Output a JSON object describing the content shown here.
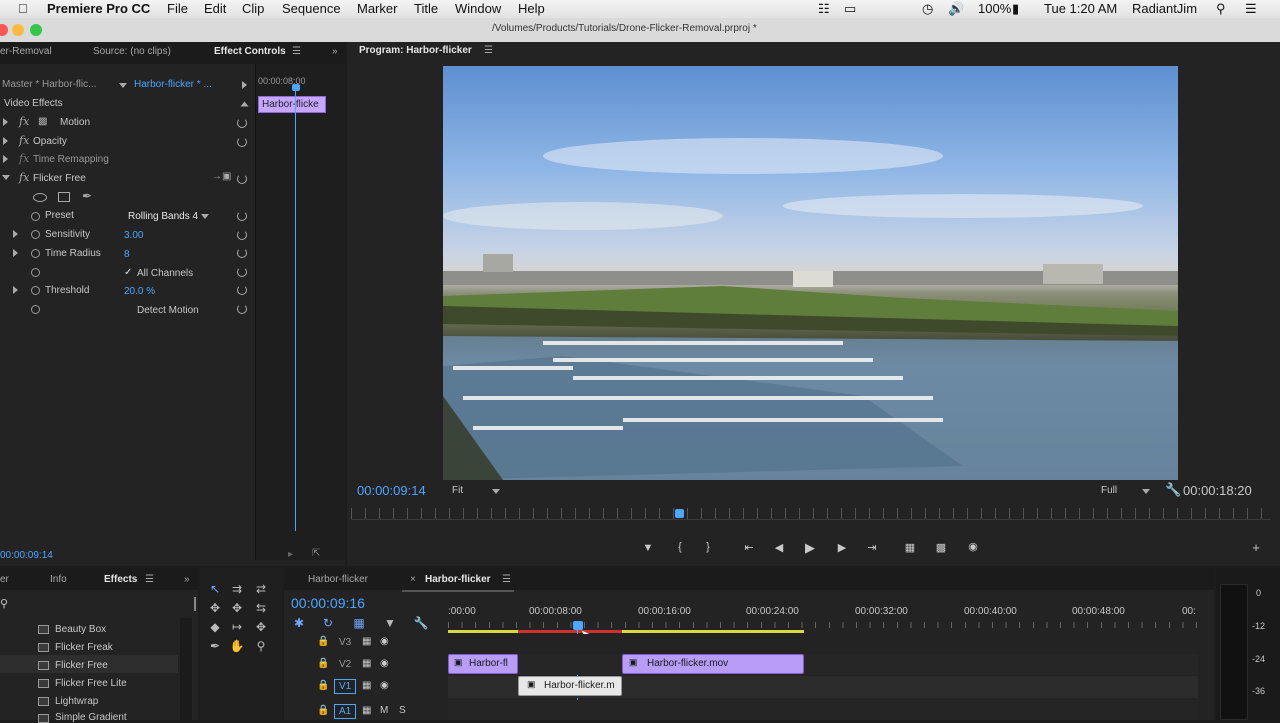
{
  "menubar": {
    "app": "Premiere Pro CC",
    "items": [
      "File",
      "Edit",
      "Clip",
      "Sequence",
      "Marker",
      "Title",
      "Window",
      "Help"
    ],
    "battery": "100%",
    "clock": "Tue 1:20 AM",
    "user": "RadiantJim"
  },
  "window": {
    "path": "/Volumes/Products/Tutorials/Drone-Flicker-Removal.prproj *"
  },
  "left_panel": {
    "tabs": [
      "er-Removal",
      "Source: (no clips)",
      "Effect Controls"
    ],
    "master_label": "Master * Harbor-flic...",
    "sequence_label": "Harbor-flicker * ...",
    "timecode_ruler": "00:00:08:00",
    "mini_clip": "Harbor-flicke",
    "section": "Video Effects",
    "effects": [
      {
        "name": "Motion"
      },
      {
        "name": "Opacity"
      },
      {
        "name": "Time Remapping"
      },
      {
        "name": "Flicker Free"
      }
    ],
    "params": {
      "preset_label": "Preset",
      "preset_value": "Rolling Bands 4",
      "sensitivity_label": "Sensitivity",
      "sensitivity_value": "3.00",
      "time_radius_label": "Time Radius",
      "time_radius_value": "8",
      "all_channels": "All Channels",
      "threshold_label": "Threshold",
      "threshold_value": "20.0 %",
      "detect_motion": "Detect Motion"
    },
    "footer_timecode": "00:00:09:14"
  },
  "program": {
    "tab": "Program: Harbor-flicker",
    "timecode": "00:00:09:14",
    "fit": "Fit",
    "quality": "Full",
    "duration": "00:00:18:20"
  },
  "effects_panel": {
    "tabs": [
      "er",
      "Info",
      "Effects"
    ],
    "items": [
      "Beauty Box",
      "Flicker Freak",
      "Flicker Free",
      "Flicker Free Lite",
      "Lightwrap",
      "Simple Gradient"
    ]
  },
  "timeline": {
    "tabs": [
      "Harbor-flicker",
      "Harbor-flicker"
    ],
    "timecode": "00:00:09:16",
    "ruler": [
      ":00:00",
      "00:00:08:00",
      "00:00:16:00",
      "00:00:24:00",
      "00:00:32:00",
      "00:00:40:00",
      "00:00:48:00",
      "00:"
    ],
    "tracks": [
      "V3",
      "V2",
      "V1",
      "A1"
    ],
    "clips": [
      "Harbor-fl",
      "Harbor-flicker.mov",
      "Harbor-flicker.m"
    ]
  },
  "meter": {
    "labels": [
      "0",
      "-12",
      "-24",
      "-36"
    ]
  }
}
